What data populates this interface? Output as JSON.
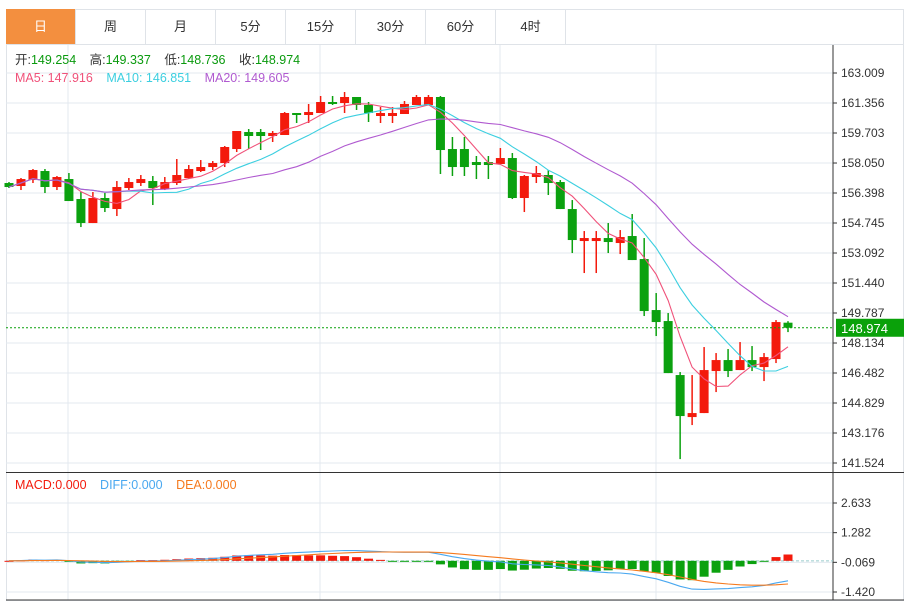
{
  "tabs": [
    "日",
    "周",
    "月",
    "5分",
    "15分",
    "30分",
    "60分",
    "4时"
  ],
  "active_tab": 0,
  "ohlc_header": {
    "open_label": "开:",
    "open": "149.254",
    "high_label": "高:",
    "high": "149.337",
    "low_label": "低:",
    "low": "148.736",
    "close_label": "收:",
    "close": "148.974"
  },
  "ma_header": {
    "ma5": "MA5: 147.916",
    "ma10": "MA10: 146.851",
    "ma20": "MA20: 149.605"
  },
  "macd_header": {
    "macd": "MACD:0.000",
    "diff": "DIFF:0.000",
    "dea": "DEA:0.000"
  },
  "colors": {
    "up": "#f31a0c",
    "down": "#0ba10f",
    "ma5": "#f0527a",
    "ma10": "#3ccfe0",
    "ma20": "#b05ad0",
    "diff": "#4aa8f0",
    "dea": "#f57a1e",
    "active_tab": "#f38f3f",
    "last_price": "#0aa10a"
  },
  "chart_data": [
    {
      "type": "candlestick",
      "title": "",
      "price_axis_labels": [
        "163.009",
        "161.356",
        "159.703",
        "158.050",
        "156.398",
        "154.745",
        "153.092",
        "151.440",
        "149.787",
        "148.134",
        "146.482",
        "144.829",
        "143.176",
        "141.524"
      ],
      "ylim": [
        141.524,
        163.009
      ],
      "last_price": "148.974",
      "candles": [
        [
          156.948,
          157.003,
          156.673,
          156.728
        ],
        [
          156.783,
          157.224,
          156.562,
          157.168
        ],
        [
          157.113,
          157.719,
          156.948,
          157.664
        ],
        [
          157.609,
          157.719,
          156.397,
          156.728
        ],
        [
          156.728,
          157.334,
          156.562,
          157.279
        ],
        [
          157.168,
          157.499,
          155.956,
          155.956
        ],
        [
          156.066,
          156.452,
          154.523,
          154.744
        ],
        [
          154.744,
          156.452,
          154.744,
          156.122
        ],
        [
          156.122,
          156.397,
          155.35,
          155.571
        ],
        [
          155.515,
          157.058,
          155.13,
          156.728
        ],
        [
          156.673,
          157.224,
          156.562,
          157.003
        ],
        [
          156.948,
          157.389,
          156.783,
          157.168
        ],
        [
          157.058,
          157.334,
          155.736,
          156.673
        ],
        [
          156.617,
          157.279,
          156.562,
          157.003
        ],
        [
          156.948,
          158.27,
          156.838,
          157.389
        ],
        [
          157.224,
          157.94,
          157.168,
          157.719
        ],
        [
          157.609,
          158.215,
          157.554,
          157.829
        ],
        [
          157.829,
          158.16,
          157.664,
          158.05
        ],
        [
          158.05,
          158.987,
          157.829,
          158.932
        ],
        [
          158.821,
          159.813,
          158.656,
          159.813
        ],
        [
          159.758,
          159.923,
          158.821,
          159.538
        ],
        [
          159.758,
          159.923,
          158.766,
          159.538
        ],
        [
          159.538,
          159.813,
          159.207,
          159.703
        ],
        [
          159.593,
          160.86,
          159.593,
          160.805
        ],
        [
          160.805,
          160.805,
          160.254,
          160.695
        ],
        [
          160.695,
          161.301,
          160.254,
          160.86
        ],
        [
          160.805,
          161.742,
          160.805,
          161.411
        ],
        [
          161.411,
          161.742,
          161.246,
          161.356
        ],
        [
          161.356,
          161.962,
          160.805,
          161.687
        ],
        [
          161.687,
          161.687,
          160.97,
          161.246
        ],
        [
          161.246,
          161.411,
          160.309,
          160.805
        ],
        [
          160.64,
          161.136,
          160.254,
          160.805
        ],
        [
          160.64,
          161.136,
          160.254,
          160.805
        ],
        [
          160.75,
          161.466,
          160.75,
          161.301
        ],
        [
          161.246,
          161.797,
          161.246,
          161.687
        ],
        [
          161.246,
          161.797,
          161.246,
          161.687
        ],
        [
          161.687,
          161.742,
          157.444,
          158.766
        ],
        [
          158.821,
          159.483,
          157.334,
          157.829
        ],
        [
          158.821,
          159.483,
          157.334,
          157.829
        ],
        [
          158.105,
          158.436,
          157.168,
          157.94
        ],
        [
          158.105,
          158.436,
          157.168,
          157.94
        ],
        [
          157.995,
          158.876,
          157.995,
          158.325
        ],
        [
          158.325,
          158.601,
          156.066,
          156.122
        ],
        [
          156.122,
          157.389,
          155.35,
          157.334
        ],
        [
          157.279,
          157.885,
          156.948,
          157.499
        ],
        [
          157.389,
          157.664,
          156.287,
          156.948
        ],
        [
          157.003,
          157.113,
          155.515,
          155.515
        ],
        [
          155.515,
          156.011,
          153.091,
          153.807
        ],
        [
          153.752,
          154.303,
          151.989,
          153.917
        ],
        [
          153.752,
          154.303,
          151.989,
          153.917
        ],
        [
          153.917,
          154.744,
          153.091,
          153.697
        ],
        [
          153.642,
          154.358,
          153.036,
          153.972
        ],
        [
          154.028,
          155.24,
          152.705,
          152.705
        ],
        [
          152.76,
          153.917,
          149.62,
          149.895
        ],
        [
          149.95,
          150.887,
          148.518,
          149.289
        ],
        [
          149.344,
          149.785,
          146.479,
          146.479
        ],
        [
          146.369,
          146.534,
          141.74,
          144.11
        ],
        [
          144.055,
          146.369,
          143.614,
          144.275
        ],
        [
          144.275,
          147.912,
          144.275,
          146.644
        ],
        [
          146.589,
          147.581,
          145.432,
          147.195
        ],
        [
          147.195,
          147.802,
          146.259,
          146.589
        ],
        [
          146.644,
          148.187,
          146.644,
          147.195
        ],
        [
          147.195,
          147.967,
          146.589,
          146.809
        ],
        [
          146.809,
          147.581,
          146.038,
          147.36
        ],
        [
          147.251,
          149.399,
          147.03,
          149.289
        ],
        [
          149.254,
          149.337,
          148.736,
          148.974
        ]
      ],
      "moving_averages": [
        5,
        10,
        20
      ]
    },
    {
      "type": "macd",
      "axis_labels": [
        "2.633",
        "1.282",
        "-0.069",
        "-1.420"
      ],
      "ylim": [
        -1.42,
        2.633
      ],
      "fast": 12,
      "slow": 26,
      "signal": 9
    }
  ]
}
